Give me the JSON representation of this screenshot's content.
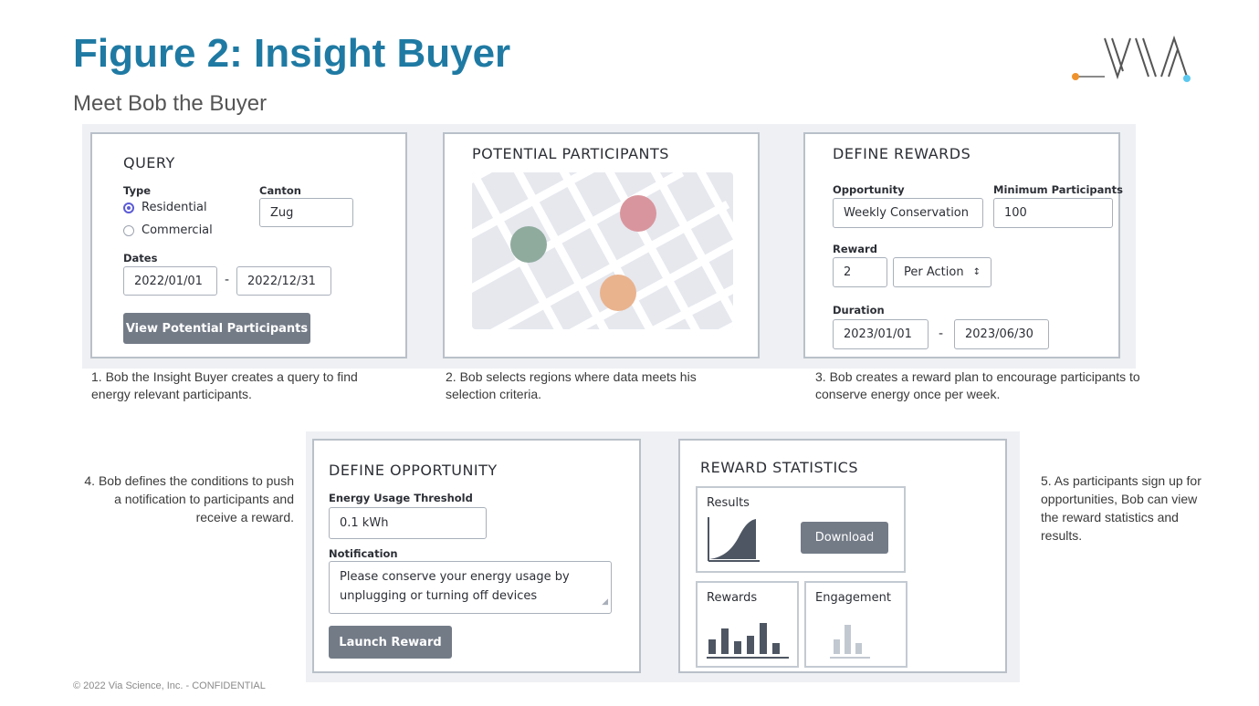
{
  "header": {
    "title": "Figure 2: Insight Buyer",
    "subtitle": "Meet Bob the Buyer",
    "logo_text": "VIA"
  },
  "query": {
    "title": "QUERY",
    "type_label": "Type",
    "options": [
      "Residential",
      "Commercial"
    ],
    "selected_option": "Residential",
    "canton_label": "Canton",
    "canton_value": "Zug",
    "dates_label": "Dates",
    "date_from": "2022/01/01",
    "date_separator": "-",
    "date_to": "2022/12/31",
    "button_label": "View Potential Participants"
  },
  "participants": {
    "title": "POTENTIAL PARTICIPANTS",
    "region_colors": [
      "#d9959d",
      "#8fab9e",
      "#e9b38e"
    ]
  },
  "rewards": {
    "title": "DEFINE REWARDS",
    "opportunity_label": "Opportunity",
    "opportunity_value": "Weekly Conservation",
    "min_participants_label": "Minimum Participants",
    "min_participants_value": "100",
    "reward_label": "Reward",
    "reward_value": "2",
    "reward_unit": "Per Action",
    "duration_label": "Duration",
    "duration_from": "2023/01/01",
    "duration_separator": "-",
    "duration_to": "2023/06/30"
  },
  "captions": {
    "step1": "1. Bob the Insight Buyer creates a query to find energy relevant participants.",
    "step2": "2. Bob selects regions where data meets his selection criteria.",
    "step3": "3. Bob creates a reward plan to encourage participants to conserve energy once per week.",
    "step4": "4.  Bob defines the conditions to push a notification to participants and receive a reward.",
    "step5": "5. As participants sign up for opportunities, Bob can view the reward statistics and results."
  },
  "opportunity": {
    "title": "DEFINE OPPORTUNITY",
    "threshold_label": "Energy Usage Threshold",
    "threshold_value": "0.1 kWh",
    "notification_label": "Notification",
    "notification_value": "Please conserve your energy usage by unplugging or turning off devices",
    "button_label": "Launch Reward"
  },
  "statistics": {
    "title": "REWARD STATISTICS",
    "results_label": "Results",
    "download_label": "Download",
    "rewards_label": "Rewards",
    "engagement_label": "Engagement"
  },
  "footer": {
    "text": "© 2022 Via Science, Inc. - CONFIDENTIAL"
  },
  "colors": {
    "title": "#1f7aa3",
    "button": "#737b87",
    "radio_selected": "#5b5bd6",
    "logo_orange": "#f0922b",
    "logo_blue": "#5bc8ef"
  }
}
